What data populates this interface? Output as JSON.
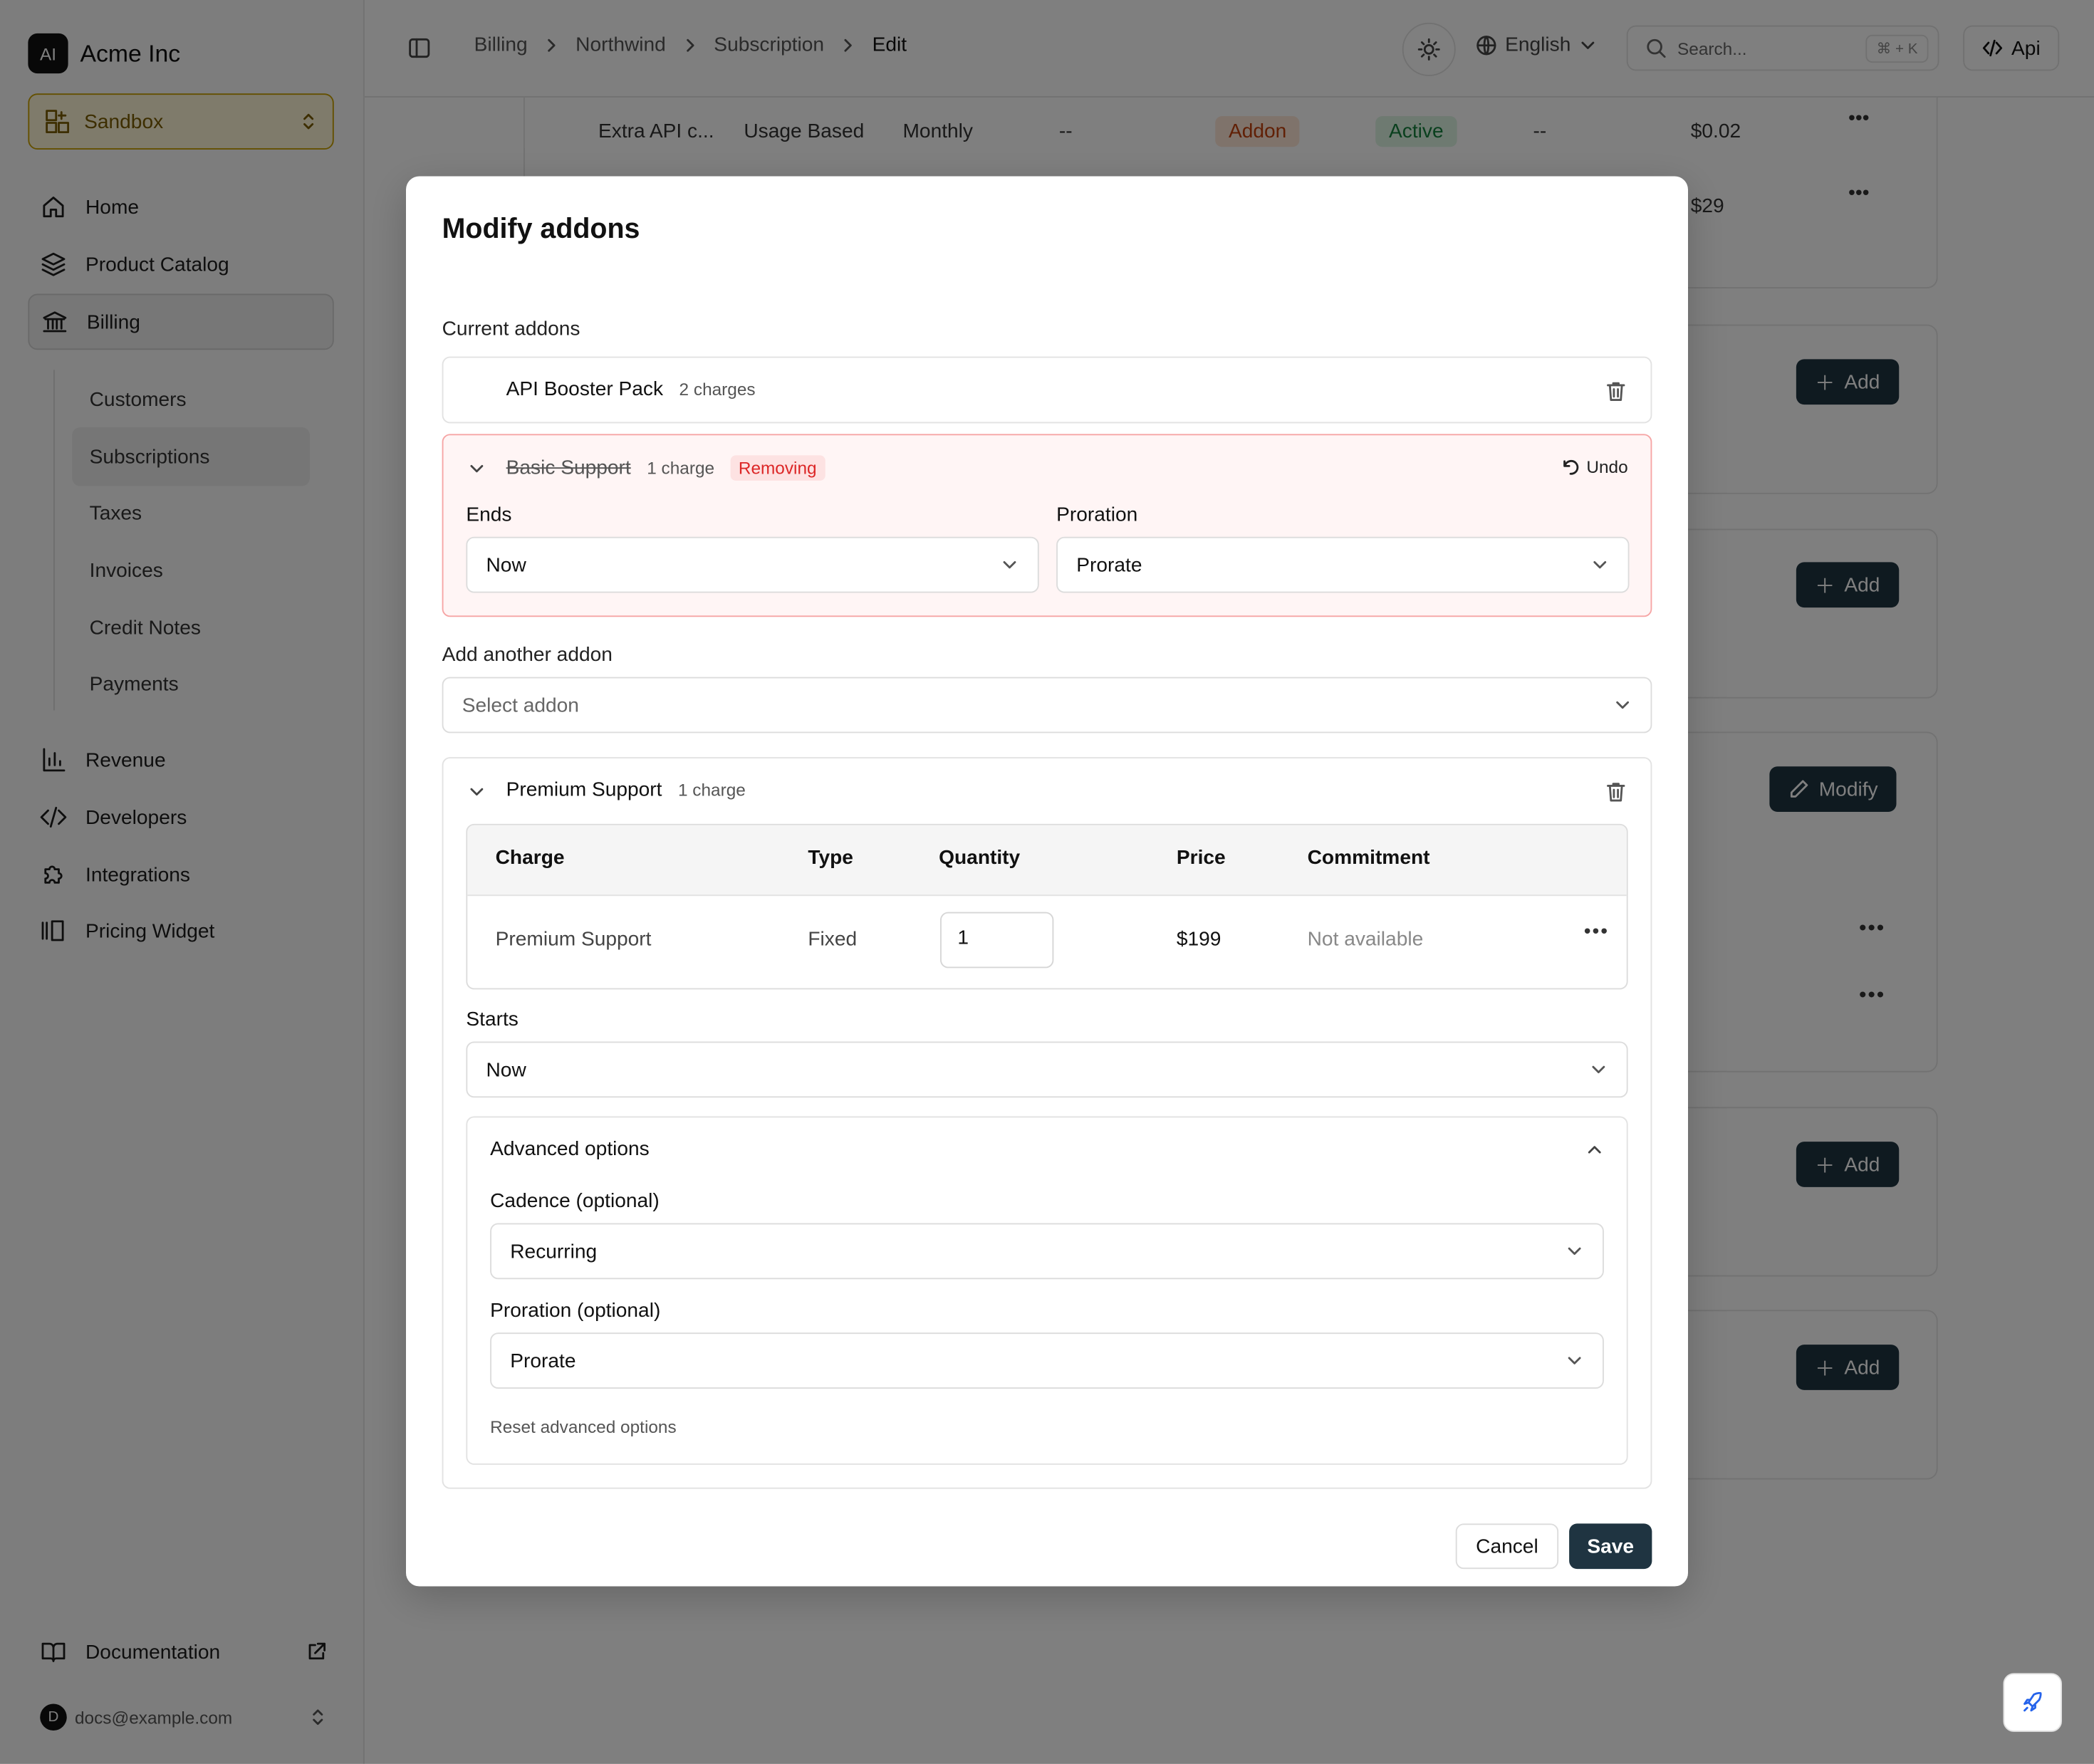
{
  "brand": {
    "logo_text": "AI",
    "name": "Acme Inc"
  },
  "environment": {
    "label": "Sandbox"
  },
  "sidebar": {
    "items": [
      {
        "label": "Home",
        "icon": "home-icon"
      },
      {
        "label": "Product Catalog",
        "icon": "layers-icon"
      },
      {
        "label": "Billing",
        "icon": "bank-icon",
        "active": true
      },
      {
        "label": "Revenue",
        "icon": "bar-chart-icon"
      },
      {
        "label": "Developers",
        "icon": "code-icon"
      },
      {
        "label": "Integrations",
        "icon": "puzzle-icon"
      },
      {
        "label": "Pricing Widget",
        "icon": "columns-icon"
      }
    ],
    "billing_sub": [
      "Customers",
      "Subscriptions",
      "Taxes",
      "Invoices",
      "Credit Notes",
      "Payments"
    ],
    "active_sub": "Subscriptions",
    "docs_label": "Documentation",
    "user": {
      "initial": "D",
      "email": "docs@example.com"
    }
  },
  "topbar": {
    "breadcrumbs": [
      "Billing",
      "Northwind",
      "Subscription",
      "Edit"
    ],
    "language": "English",
    "search_placeholder": "Search...",
    "search_shortcut": "⌘ + K",
    "api_label": "Api"
  },
  "background": {
    "row1": {
      "name": "Extra API c...",
      "type": "Usage Based",
      "cadence": "Monthly",
      "c1": "--",
      "badge_type": "Addon",
      "badge_status": "Active",
      "c2": "--",
      "price": "$0.02"
    },
    "row2_price": "$29",
    "add_label": "Add",
    "modify_label": "Modify"
  },
  "modal": {
    "title": "Modify addons",
    "current_label": "Current addons",
    "addon1": {
      "name": "API Booster Pack",
      "meta": "2 charges"
    },
    "addon2": {
      "name": "Basic Support",
      "meta": "1 charge",
      "status": "Removing",
      "undo": "Undo",
      "ends_label": "Ends",
      "ends_value": "Now",
      "proration_label": "Proration",
      "proration_value": "Prorate"
    },
    "add_another_label": "Add another addon",
    "select_placeholder": "Select addon",
    "addon3": {
      "name": "Premium Support",
      "meta": "1 charge",
      "columns": [
        "Charge",
        "Type",
        "Quantity",
        "Price",
        "Commitment"
      ],
      "row": {
        "charge": "Premium Support",
        "type": "Fixed",
        "quantity": "1",
        "price": "$199",
        "commitment": "Not available"
      },
      "starts_label": "Starts",
      "starts_value": "Now",
      "advanced_label": "Advanced options",
      "cadence_label": "Cadence (optional)",
      "cadence_value": "Recurring",
      "proration_label": "Proration (optional)",
      "proration_value": "Prorate",
      "reset_label": "Reset advanced options"
    },
    "cancel": "Cancel",
    "save": "Save"
  }
}
